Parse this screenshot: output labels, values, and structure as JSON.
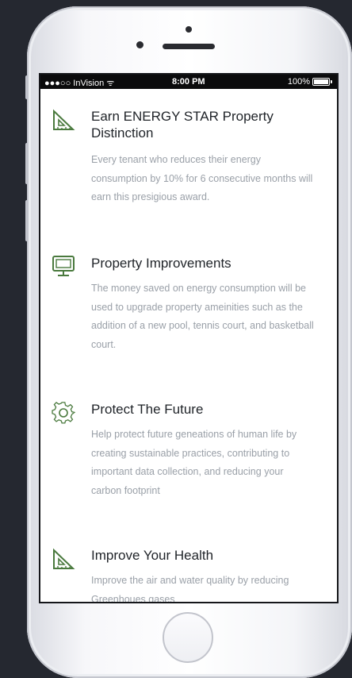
{
  "status_bar": {
    "carrier": "●●●○○ InVision ᯤ",
    "time": "8:00 PM",
    "battery": "100%"
  },
  "features": [
    {
      "icon": "set-square-icon",
      "title": "Earn ENERGY STAR Property Distinction",
      "body": "Every tenant who reduces their energy consumption by 10% for 6 consecutive months will earn this presigious award."
    },
    {
      "icon": "monitor-icon",
      "title": "Property Improvements",
      "body": "The money saved on energy consumption will be used to upgrade property ameinities such as the addition of a new pool, tennis court, and basketball court."
    },
    {
      "icon": "gear-icon",
      "title": "Protect The Future",
      "body": "Help protect future geneations of human life by creating sustainable practices, contributing to important data collection, and reducing your carbon footprint"
    },
    {
      "icon": "set-square-icon",
      "title": "Improve Your Health",
      "body": "Improve the air and water quality by reducing Greenhoues gases"
    }
  ],
  "colors": {
    "icon_green": "#4a7a3e",
    "title_text": "#1f2328",
    "body_text": "#9aa0a8",
    "page_background": "#252830"
  }
}
